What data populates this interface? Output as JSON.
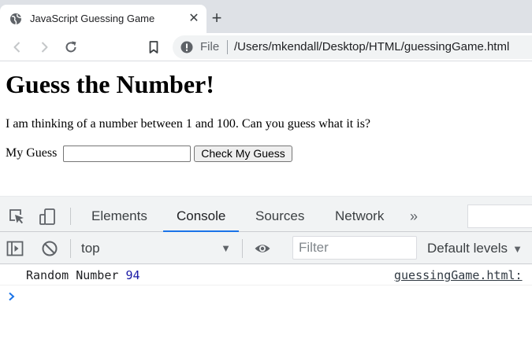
{
  "browser": {
    "tab_title": "JavaScript Guessing Game",
    "tab_close": "✕",
    "new_tab": "+",
    "url_scheme": "File",
    "url_path": "/Users/mkendall/Desktop/HTML/guessingGame.html",
    "icons": [
      "globe-icon",
      "close-icon",
      "plus-icon",
      "back-arrow-icon",
      "forward-arrow-icon",
      "reload-icon",
      "bookmark-icon",
      "info-icon"
    ]
  },
  "page": {
    "heading": "Guess the Number!",
    "intro": "I am thinking of a number between 1 and 100. Can you guess what it is?",
    "guess_label": "My Guess",
    "guess_value": "",
    "check_button": "Check My Guess"
  },
  "devtools": {
    "tabs": [
      {
        "label": "Elements",
        "active": false
      },
      {
        "label": "Console",
        "active": true
      },
      {
        "label": "Sources",
        "active": false
      },
      {
        "label": "Network",
        "active": false
      }
    ],
    "more": "»",
    "context": "top",
    "filter_placeholder": "Filter",
    "levels": "Default levels",
    "log": {
      "text": "Random Number",
      "number": "94",
      "source": "guessingGame.html:"
    },
    "colors": {
      "accent": "#1a73e8",
      "number": "#1a1aa6"
    }
  }
}
